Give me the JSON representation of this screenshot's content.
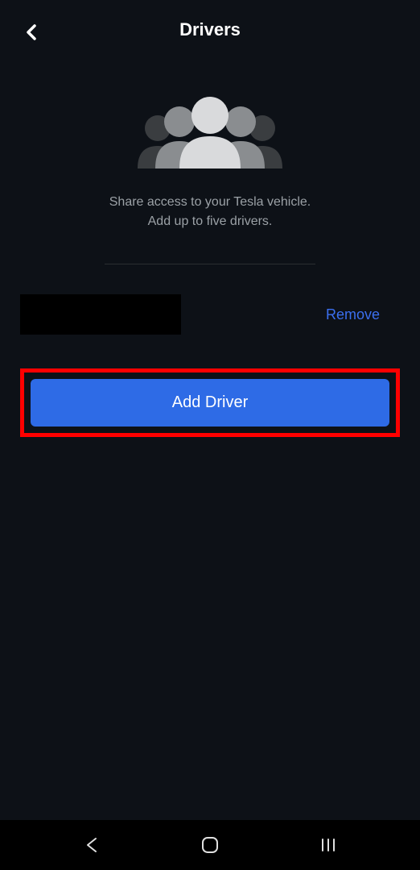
{
  "header": {
    "title": "Drivers"
  },
  "description": {
    "line1": "Share access to your Tesla vehicle.",
    "line2": "Add up to five drivers."
  },
  "driver_row": {
    "remove_label": "Remove"
  },
  "actions": {
    "add_driver_label": "Add Driver"
  },
  "colors": {
    "accent": "#2e6be6",
    "link": "#3b6fef",
    "highlight": "#ff0000"
  }
}
